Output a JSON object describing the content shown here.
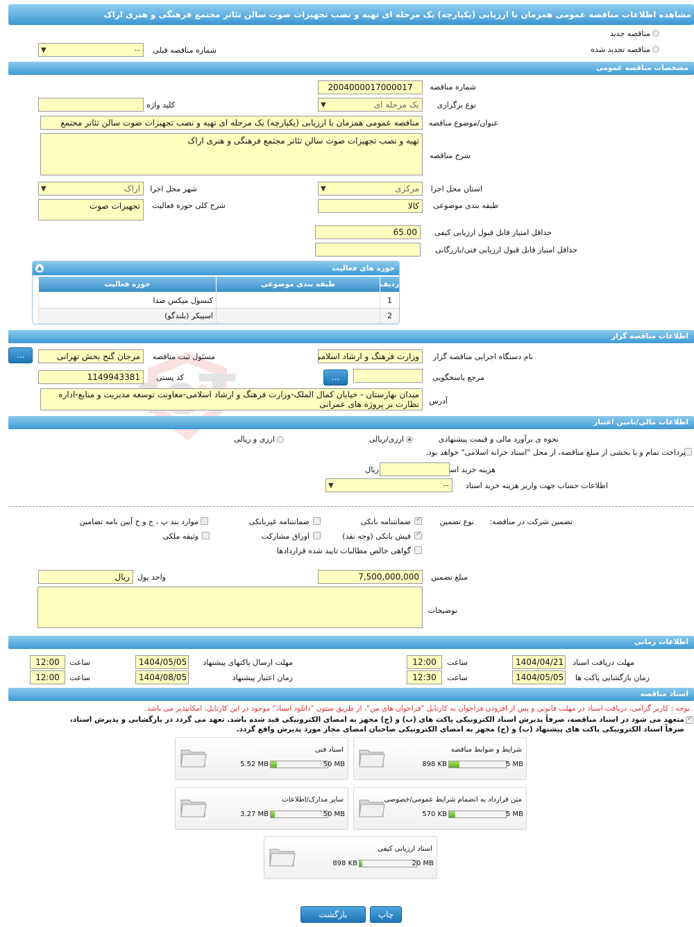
{
  "page_title": "مشاهده اطلاعات مناقصه عمومی همزمان با ارزیابی (یکپارچه) یک مرحله ای تهیه و نصب تجهیزات صوت سالن تئاتر مجتمع فرهنگی و هنری اراک",
  "top": {
    "new_tender": "مناقصه جدید",
    "renewed_tender": "مناقصه تجدید شده",
    "prev_tender_label": "شماره مناقصه قبلی",
    "prev_tender_value": "--"
  },
  "sections": {
    "general": "مشخصات مناقصه عمومی",
    "organizer": "اطلاعات مناقصه گزار",
    "financial": "اطلاعات مالی/تامین اعتبار",
    "timing": "اطلاعات زمانی",
    "docs": "اسناد مناقصه"
  },
  "general": {
    "tender_no_label": "شماره مناقصه",
    "tender_no": "2004000017000017",
    "holding_type_label": "نوع برگزاری",
    "holding_type": "یک مرحله ای",
    "keyword_label": "کلید واژه",
    "keyword": "",
    "subject_label": "عنوان/موضوع مناقصه",
    "subject": "مناقصه عمومی همزمان با ارزیابی (یکپارچه) یک مرحله ای تهیه و نصب تجهیزات صوت سالن تئاتر مجتمع",
    "desc_label": "شرح مناقصه",
    "desc": "تهیه و نصب تجهیزات صوت سالن تئاتر مجتمع فرهنگی و هنری اراک",
    "province_label": "استان محل اجرا",
    "province": "مرکزی",
    "city_label": "شهر محل اجرا",
    "city": "اراک",
    "category_label": "طبقه بندی موضوعی",
    "category": "کالا",
    "scope_label": "شرح کلی حوزه فعالیت",
    "scope": "تجهیزات صوت",
    "min_quality_label": "حداقل امتیاز قابل قبول ارزیابی کیفی",
    "min_quality": "65.00",
    "min_tech_label": "حداقل امتیاز قابل قبول ارزیابی فنی/بازرگانی",
    "min_tech": ""
  },
  "activity_grid": {
    "title": "حوزه های فعالیت",
    "col_row": "ردیف",
    "col_category": "طبقه بندی موضوعی",
    "col_activity": "حوزه فعالیت",
    "rows": [
      {
        "n": "1",
        "category": "",
        "activity": "کنسول میکس صدا"
      },
      {
        "n": "2",
        "category": "",
        "activity": "اسپیکر (بلندگو)"
      }
    ]
  },
  "organizer": {
    "org_label": "نام دستگاه اجرایی مناقصه گزار",
    "org": "وزارت فرهنگ و ارشاد اسلامی",
    "registrar_label": "مسئول ثبت مناقصه",
    "registrar": "مرجان گنج بخش تهرانی",
    "responder_label": "مرجع پاسخگویی",
    "responder": "",
    "postal_label": "کد پستی",
    "postal": "1149943381",
    "address_label": "آدرس",
    "address": "میدان بهارستان - خیابان کمال الملک-وزارت فرهنگ و ارشاد اسلامی-معاونت توسعه مدیریت و منابع-اداره نظارت بر پروژه های عمرانی",
    "dots": "..."
  },
  "financial": {
    "estimate_label": "نحوه ی برآورد مالی و قیمت پیشنهادی",
    "opt_rial": "ارزی/ریالی",
    "opt_both": "ارزی و ریالی",
    "treasury_text": "پرداخت تمام و یا بخشی از مبلغ مناقصه، از محل \"اسناد خزانه اسلامی\" خواهد بود.",
    "doc_fee_label": "هزینه خرید اسناد",
    "doc_fee": "",
    "rial": "ریال",
    "account_label": "اطلاعات حساب جهت واریز هزینه خرید اسناد",
    "account": "--"
  },
  "guarantee": {
    "label": "تضمین شرکت در مناقصه:",
    "type_label": "نوع تضمین",
    "bank_guarantee": "ضمانتنامه بانکی",
    "nonbank_guarantee": "ضمانتنامه غیربانکی",
    "regulation": "موارد بند پ ، ج و خ آیین نامه تضامین",
    "bank_receipt": "فیش بانکی (وجه نقد)",
    "bonds": "اوراق مشارکت",
    "property": "وثیقه ملکی",
    "net_claims": "گواهی خالص مطالبات تایید شده قراردادها",
    "amount_label": "مبلغ تضمین",
    "amount": "7,500,000,000",
    "currency_label": "واحد پول",
    "currency": "ریال",
    "notes_label": "توضیحات",
    "notes": ""
  },
  "timing": {
    "receive_label": "مهلت دریافت اسناد",
    "receive_date": "1404/04/21",
    "receive_time": "12:00",
    "submit_label": "مهلت ارسال پاکتهای پیشنهاد",
    "submit_date": "1404/05/05",
    "submit_time": "12:00",
    "open_label": "زمان بازگشایی پاکت ها",
    "open_date": "1404/05/05",
    "open_time": "12:30",
    "validity_label": "زمان اعتبار پیشنهاد",
    "validity_date": "1404/08/05",
    "validity_time": "12:00",
    "time_label": "ساعت"
  },
  "docs": {
    "notice": "توجه : کاربر گرامی، دریافت اسناد در مهلت قانونی و پس از افزودن فراخوان به کارتابل \"فراخوان های من\"، از طریق ستون \"دانلود اسناد\" موجود در این کارتابل، امکانپذیر می باشد.",
    "pledge_line1": "متعهد می شود در اسناد مناقصه، صرفاً پذیرش اسناد الکترونیکی پاکت های (ب) و (ج) مجهز به امضای الکترونیکی قید شده باشد. تعهد می گردد در بازگشایی و پذیرش اسناد،",
    "pledge_line2": "صرفاً اسناد الکترونیکی پاکت های پیشنهاد (ب) و (ج) مجهز به امضای الکترونیکی صاحبان امضای مجاز مورد پذیرش واقع گردد.",
    "files": [
      {
        "title": "شرایط و ضوابط مناقصه",
        "size": "898 KB",
        "max": "5 MB",
        "pct": 0.18
      },
      {
        "title": "اسناد فنی",
        "size": "5.52 MB",
        "max": "50 MB",
        "pct": 0.11
      },
      {
        "title": "متن قرارداد به انضمام شرایط عمومی/خصوصی",
        "size": "570 KB",
        "max": "5 MB",
        "pct": 0.11
      },
      {
        "title": "سایر مدارک/اطلاعات",
        "size": "3.27 MB",
        "max": "50 MB",
        "pct": 0.07
      },
      {
        "title": "اسناد ارزیابی کیفی",
        "size": "898 KB",
        "max": "20 MB",
        "pct": 0.04
      }
    ]
  },
  "buttons": {
    "print": "چاپ",
    "back": "بازگشت"
  },
  "watermark": "AriaTender.neT"
}
